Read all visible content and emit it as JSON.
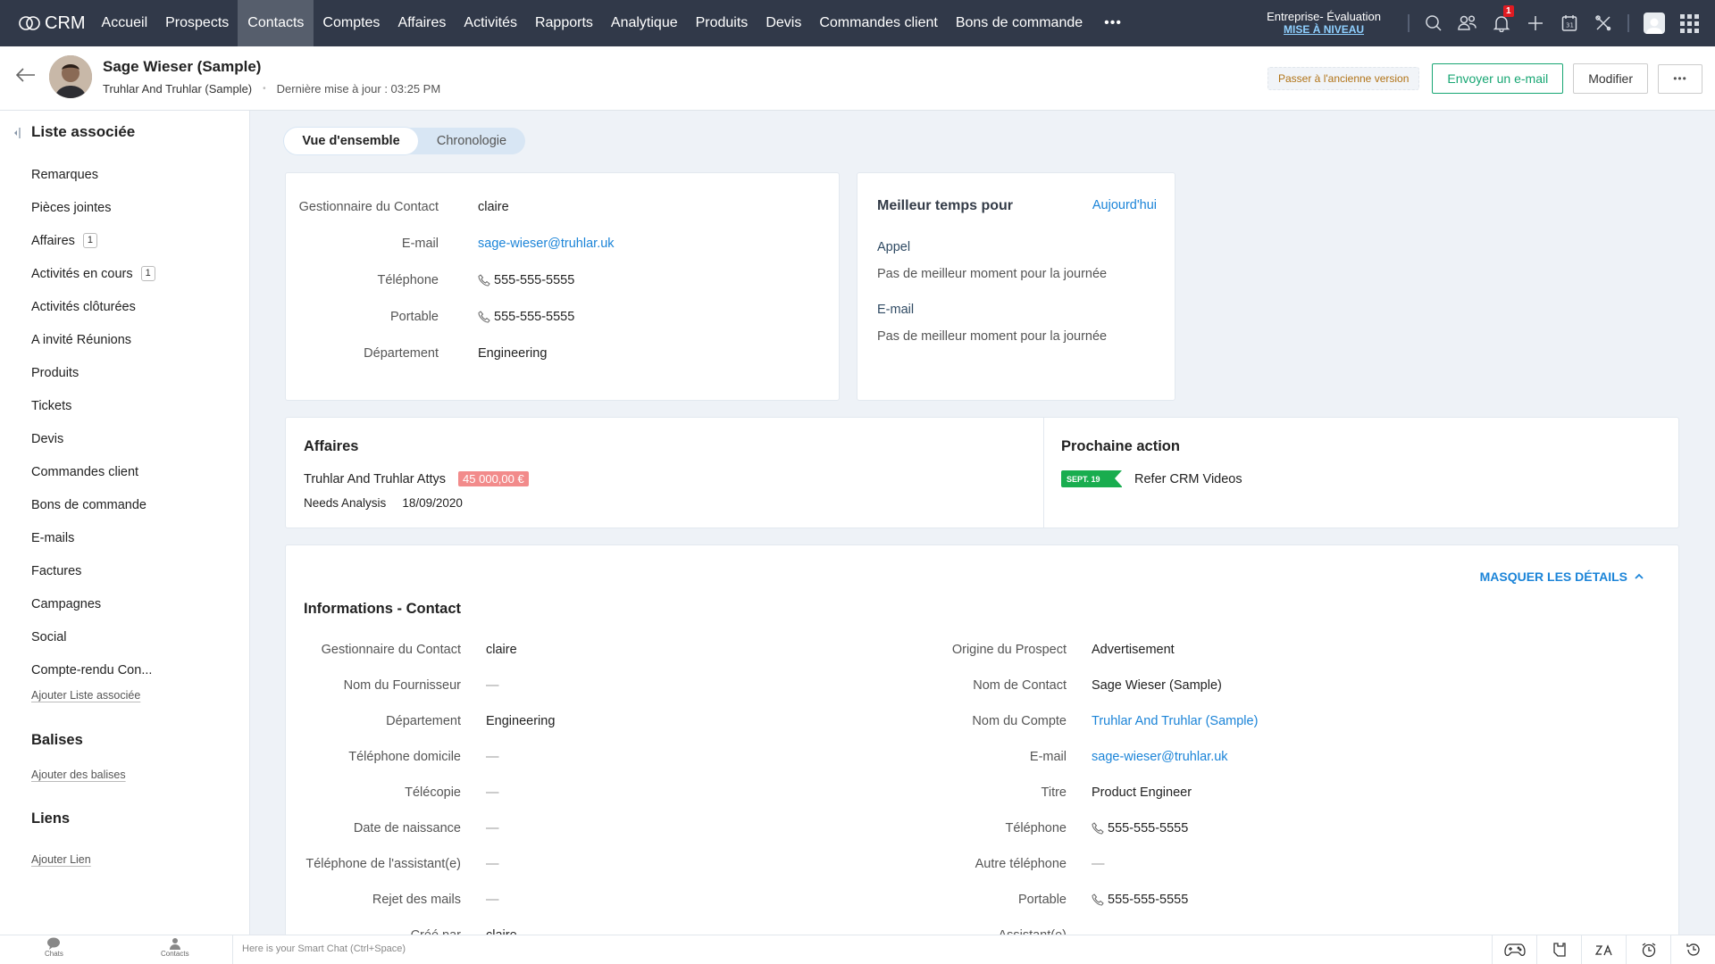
{
  "app": {
    "name": "CRM"
  },
  "nav": {
    "items": [
      {
        "label": "Accueil",
        "active": false
      },
      {
        "label": "Prospects",
        "active": false
      },
      {
        "label": "Contacts",
        "active": true
      },
      {
        "label": "Comptes",
        "active": false
      },
      {
        "label": "Affaires",
        "active": false
      },
      {
        "label": "Activités",
        "active": false
      },
      {
        "label": "Rapports",
        "active": false
      },
      {
        "label": "Analytique",
        "active": false
      },
      {
        "label": "Produits",
        "active": false
      },
      {
        "label": "Devis",
        "active": false
      },
      {
        "label": "Commandes client",
        "active": false
      },
      {
        "label": "Bons de commande",
        "active": false
      }
    ],
    "more_label": "•••",
    "edition": "Entreprise- Évaluation",
    "upgrade": "MISE À NIVEAU",
    "notification_count": "1",
    "calendar_day": "31",
    "icons": [
      "search-icon",
      "contacts-icon",
      "bell-icon",
      "plus-icon",
      "calendar-icon",
      "tools-icon",
      "user-avatar",
      "apps-grid-icon"
    ]
  },
  "record": {
    "name": "Sage Wieser (Sample)",
    "account": "Truhlar And Truhlar (Sample)",
    "separator": "•",
    "last_updated": "Dernière mise à jour : 03:25 PM",
    "actions": {
      "old_version": "Passer à l'ancienne version",
      "send_email": "Envoyer un e-mail",
      "edit": "Modifier",
      "more": "•••"
    }
  },
  "sidebar": {
    "title": "Liste associée",
    "items": [
      {
        "label": "Remarques",
        "count": null
      },
      {
        "label": "Pièces jointes",
        "count": null
      },
      {
        "label": "Affaires",
        "count": "1"
      },
      {
        "label": "Activités en cours",
        "count": "1"
      },
      {
        "label": "Activités clôturées",
        "count": null
      },
      {
        "label": "A invité Réunions",
        "count": null
      },
      {
        "label": "Produits",
        "count": null
      },
      {
        "label": "Tickets",
        "count": null
      },
      {
        "label": "Devis",
        "count": null
      },
      {
        "label": "Commandes client",
        "count": null
      },
      {
        "label": "Bons de commande",
        "count": null
      },
      {
        "label": "E-mails",
        "count": null
      },
      {
        "label": "Factures",
        "count": null
      },
      {
        "label": "Campagnes",
        "count": null
      },
      {
        "label": "Social",
        "count": null
      },
      {
        "label": "Compte-rendu Con...",
        "count": null
      }
    ],
    "add_related": "Ajouter Liste associée",
    "tags_title": "Balises",
    "add_tags": "Ajouter des balises",
    "links_title": "Liens",
    "add_link": "Ajouter Lien"
  },
  "tabs": [
    {
      "label": "Vue d'ensemble",
      "active": true
    },
    {
      "label": "Chronologie",
      "active": false
    }
  ],
  "overview": {
    "fields": [
      {
        "label": "Gestionnaire du Contact",
        "value": "claire",
        "type": "text"
      },
      {
        "label": "E-mail",
        "value": "sage-wieser@truhlar.uk",
        "type": "link"
      },
      {
        "label": "Téléphone",
        "value": "555-555-5555",
        "type": "phone"
      },
      {
        "label": "Portable",
        "value": "555-555-5555",
        "type": "phone"
      },
      {
        "label": "Département",
        "value": "Engineering",
        "type": "text"
      }
    ]
  },
  "best_time": {
    "title": "Meilleur temps pour",
    "period": "Aujourd'hui",
    "call_label": "Appel",
    "call_text": "Pas de meilleur moment pour la journée",
    "email_label": "E-mail",
    "email_text": "Pas de meilleur moment pour la journée"
  },
  "deals": {
    "title": "Affaires",
    "name": "Truhlar And Truhlar Attys",
    "amount": "45 000,00 €",
    "stage": "Needs Analysis",
    "date": "18/09/2020",
    "amount_color": "#f28b8b"
  },
  "next_action": {
    "title": "Prochaine action",
    "date": "SEPT. 19",
    "text": "Refer CRM Videos",
    "flag_color": "#19ad4f"
  },
  "info": {
    "hide_details": "MASQUER LES DÉTAILS",
    "title": "Informations - Contact",
    "left": [
      {
        "label": "Gestionnaire du Contact",
        "value": "claire",
        "type": "text"
      },
      {
        "label": "Nom du Fournisseur",
        "value": "—",
        "type": "empty"
      },
      {
        "label": "Département",
        "value": "Engineering",
        "type": "text"
      },
      {
        "label": "Téléphone domicile",
        "value": "—",
        "type": "empty"
      },
      {
        "label": "Télécopie",
        "value": "—",
        "type": "empty"
      },
      {
        "label": "Date de naissance",
        "value": "—",
        "type": "empty"
      },
      {
        "label": "Téléphone de l'assistant(e)",
        "value": "—",
        "type": "empty"
      },
      {
        "label": "Rejet des mails",
        "value": "—",
        "type": "empty"
      },
      {
        "label": "Créé par",
        "value": "claire",
        "type": "text"
      }
    ],
    "right": [
      {
        "label": "Origine du Prospect",
        "value": "Advertisement",
        "type": "text"
      },
      {
        "label": "Nom de Contact",
        "value": "Sage Wieser (Sample)",
        "type": "text"
      },
      {
        "label": "Nom du Compte",
        "value": "Truhlar And Truhlar (Sample)",
        "type": "link"
      },
      {
        "label": "E-mail",
        "value": "sage-wieser@truhlar.uk",
        "type": "link"
      },
      {
        "label": "Titre",
        "value": "Product Engineer",
        "type": "text"
      },
      {
        "label": "Téléphone",
        "value": "555-555-5555",
        "type": "phone"
      },
      {
        "label": "Autre téléphone",
        "value": "—",
        "type": "empty"
      },
      {
        "label": "Portable",
        "value": "555-555-5555",
        "type": "phone"
      },
      {
        "label": "Assistant(e)",
        "value": "—",
        "type": "empty"
      }
    ]
  },
  "bottombar": {
    "chats": "Chats",
    "contacts": "Contacts",
    "smartchat_placeholder": "Here is your Smart Chat (Ctrl+Space)",
    "icons": [
      "gamepad-icon",
      "notes-icon",
      "translate-icon",
      "alarm-icon",
      "history-icon"
    ]
  },
  "colors": {
    "nav_bg": "#313949",
    "nav_active": "#565e6c",
    "accent_blue": "#1b84d8",
    "accent_green": "#17a673",
    "page_bg": "#eef2f7"
  }
}
